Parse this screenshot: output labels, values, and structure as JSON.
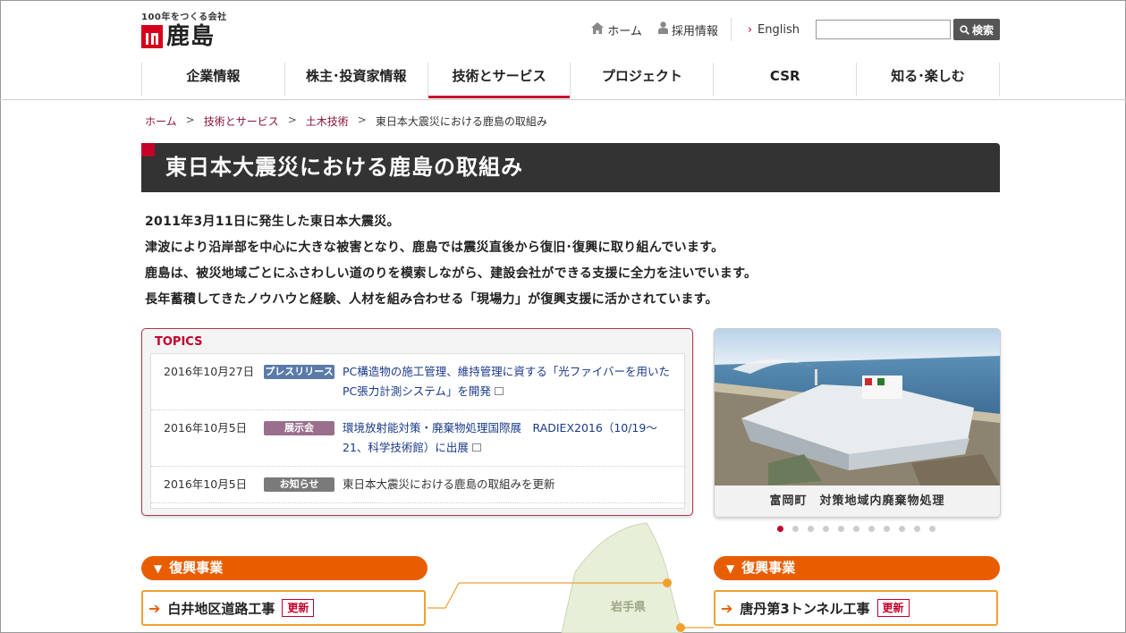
{
  "logo": {
    "tagline": "100年をつくる会社",
    "name": "鹿島"
  },
  "util_nav": {
    "home": "ホーム",
    "recruit": "採用情報",
    "english": "English",
    "search_placeholder": "",
    "search_button": "検索"
  },
  "global_nav": [
    "企業情報",
    "株主･投資家情報",
    "技術とサービス",
    "プロジェクト",
    "CSR",
    "知る･楽しむ"
  ],
  "breadcrumb": [
    "ホーム",
    "技術とサービス",
    "土木技術",
    "東日本大震災における鹿島の取組み"
  ],
  "page_title": "東日本大震災における鹿島の取組み",
  "intro": [
    "2011年3月11日に発生した東日本大震災。",
    "津波により沿岸部を中心に大きな被害となり、鹿島では震災直後から復旧･復興に取り組んでいます。",
    "鹿島は、被災地域ごとにふさわしい道のりを模索しながら、建設会社ができる支援に全力を注いでいます。",
    "長年蓄積してきたノウハウと経験、人材を組み合わせる「現場力」が復興支援に活かされています。"
  ],
  "topics": {
    "heading": "TOPICS",
    "items": [
      {
        "date": "2016年10月27日",
        "badge": "プレスリリース",
        "badge_color": "#5a7aa8",
        "text": "PC構造物の施工管理、維持管理に資する「光ファイバーを用いたPC張力計測システム」を開発",
        "external": true
      },
      {
        "date": "2016年10月5日",
        "badge": "展示会",
        "badge_color": "#9a6f8d",
        "text": "環境放射能対策・廃棄物処理国際展　RADIEX2016（10/19～21、科学技術館）に出展",
        "external": true
      },
      {
        "date": "2016年10月5日",
        "badge": "お知らせ",
        "badge_color": "#7a7a7a",
        "text": "東日本大震災における鹿島の取組みを更新",
        "external": false
      }
    ]
  },
  "slider": {
    "caption": "富岡町　対策地域内廃棄物処理",
    "total_slides": 11,
    "active_slide": 1
  },
  "map": {
    "prefecture": "岩手県"
  },
  "projects": [
    {
      "category": "復興事業",
      "name": "白井地区道路工事",
      "badge": "更新"
    },
    {
      "category": "復興事業",
      "name": "唐丹第3トンネル工事",
      "badge": "更新"
    }
  ],
  "colors": {
    "accent": "#c4002a",
    "orange": "#e85d00",
    "title_bg": "#333333"
  }
}
